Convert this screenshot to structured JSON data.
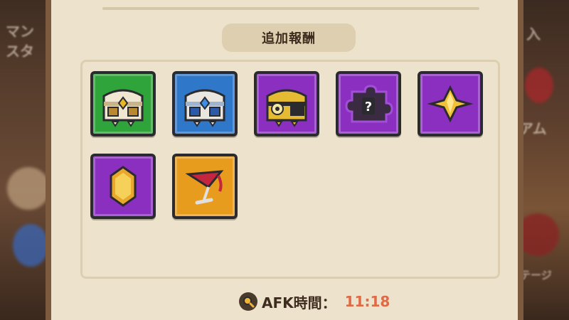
{
  "background": {
    "left_text": "マン\nスタ",
    "right_text_top": "入",
    "right_text_mid": "アム",
    "right_text_bottom": "ステージ"
  },
  "rewards": {
    "title": "追加報酬",
    "items": [
      {
        "name": "green-chest-icon",
        "bg": "#2fa43a"
      },
      {
        "name": "blue-chest-icon",
        "bg": "#2e77c9"
      },
      {
        "name": "gold-chest-icon",
        "bg": "#8b2fc1"
      },
      {
        "name": "mystery-piece-icon",
        "bg": "#8b2fc1"
      },
      {
        "name": "gold-shard-icon",
        "bg": "#8b2fc1"
      },
      {
        "name": "amber-gem-icon",
        "bg": "#8b2fc1"
      },
      {
        "name": "red-wine-glass-icon",
        "bg": "#e79c1d"
      }
    ]
  },
  "afk": {
    "label": "AFK時間：",
    "time": "11:18",
    "icon": "magnifier-clock-icon"
  },
  "colors": {
    "panel": "#ede3cc",
    "accent_time": "#e06a45",
    "text": "#3e2d1f"
  }
}
